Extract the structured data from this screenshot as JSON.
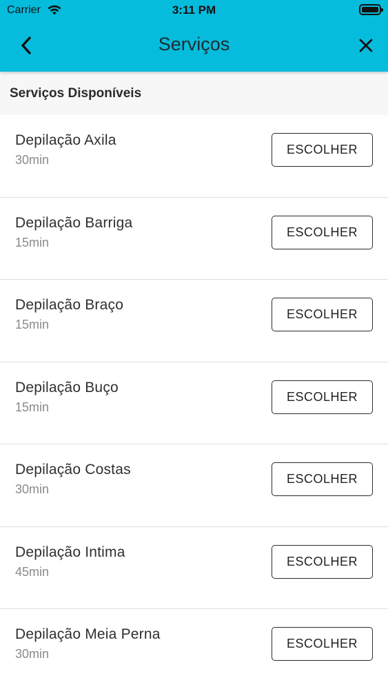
{
  "status_bar": {
    "carrier": "Carrier",
    "time": "3:11 PM"
  },
  "header": {
    "title": "Serviços"
  },
  "section": {
    "title": "Serviços Disponíveis"
  },
  "services": [
    {
      "name": "Depilação Axila",
      "duration": "30min",
      "button": "ESCOLHER"
    },
    {
      "name": "Depilação Barriga",
      "duration": "15min",
      "button": "ESCOLHER"
    },
    {
      "name": "Depilação Braço",
      "duration": "15min",
      "button": "ESCOLHER"
    },
    {
      "name": "Depilação Buço",
      "duration": "15min",
      "button": "ESCOLHER"
    },
    {
      "name": "Depilação Costas",
      "duration": "30min",
      "button": "ESCOLHER"
    },
    {
      "name": "Depilação Intima",
      "duration": "45min",
      "button": "ESCOLHER"
    },
    {
      "name": "Depilação Meia Perna",
      "duration": "30min",
      "button": "ESCOLHER"
    }
  ],
  "colors": {
    "accent": "#06bcdc",
    "section_bg": "#f7f7f7",
    "divider": "#dedede"
  },
  "icons": {
    "back": "chevron-left-icon",
    "close": "close-icon",
    "wifi": "wifi-icon",
    "battery": "battery-icon"
  }
}
